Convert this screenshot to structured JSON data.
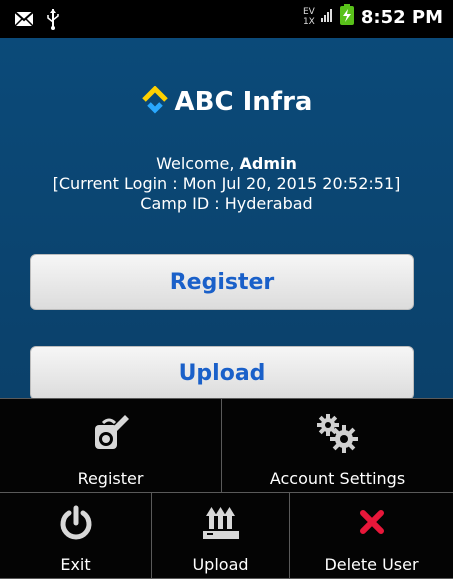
{
  "status_bar": {
    "network_top": "EV",
    "network_bottom": "1X",
    "time": "8:52 PM"
  },
  "brand": {
    "name": "ABC Infra",
    "logo_color": "#ffd000",
    "logo_color2": "#29a8ff"
  },
  "welcome": {
    "prefix": "Welcome, ",
    "user": "Admin",
    "login_line": "[Current Login : Mon Jul 20, 2015 20:52:51]",
    "camp_line": "Camp ID : Hyderabad"
  },
  "buttons": {
    "register": "Register",
    "upload": "Upload"
  },
  "menu": {
    "register": "Register",
    "account_settings": "Account Settings",
    "exit": "Exit",
    "upload": "Upload",
    "delete_user": "Delete User"
  }
}
